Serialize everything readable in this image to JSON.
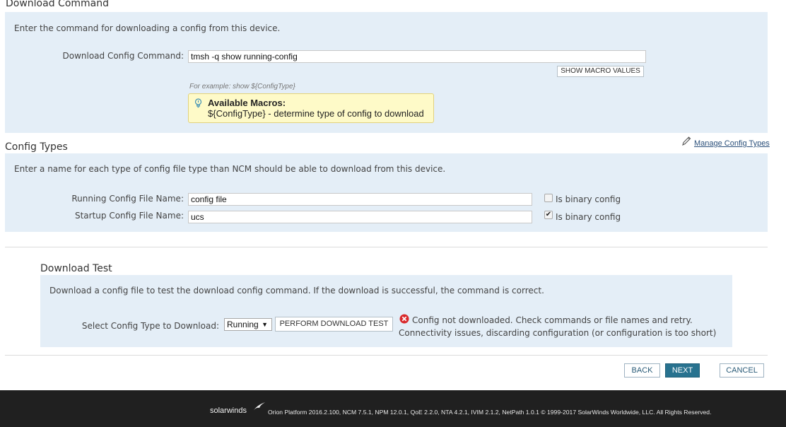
{
  "download_command": {
    "title": "Download Command",
    "intro": "Enter the command for downloading a config from this device.",
    "field_label": "Download Config Command:",
    "field_value": "tmsh -q show running-config",
    "show_macros_label": "SHOW MACRO VALUES",
    "example_hint": "For example: show ${ConfigType}",
    "macros": {
      "title": "Available Macros:",
      "line": "${ConfigType} - determine type of config to download",
      "icon": "lightbulb-icon"
    }
  },
  "config_types": {
    "title": "Config Types",
    "manage_link": "Manage Config Types",
    "intro": "Enter a name for each type of config file type than NCM should be able to download from this device.",
    "rows": [
      {
        "label": "Running Config File Name:",
        "value": "config file",
        "binary_label": "Is binary config",
        "binary_checked": false
      },
      {
        "label": "Startup Config File Name:",
        "value": "ucs",
        "binary_label": "Is binary config",
        "binary_checked": true
      }
    ]
  },
  "download_test": {
    "title": "Download Test",
    "intro": "Download a config file to test the download config command. If the download is successful, the command is correct.",
    "select_label": "Select Config Type to Download:",
    "select_value": "Running",
    "perform_label": "PERFORM DOWNLOAD TEST",
    "error_line1": "Config not downloaded. Check commands or file names and retry.",
    "error_line2": "Connectivity issues, discarding configuration (or configuration is too short)",
    "error_color": "#d9292b"
  },
  "nav": {
    "back": "BACK",
    "next": "NEXT",
    "cancel": "CANCEL",
    "next_color": "#28728f"
  },
  "footer": {
    "logo": "solarwinds",
    "text": "Orion Platform 2016.2.100, NCM 7.5.1, NPM 12.0.1, QoE 2.2.0, NTA 4.2.1, IVIM 2.1.2, NetPath 1.0.1 © 1999-2017 SolarWinds Worldwide, LLC. All Rights Reserved."
  }
}
